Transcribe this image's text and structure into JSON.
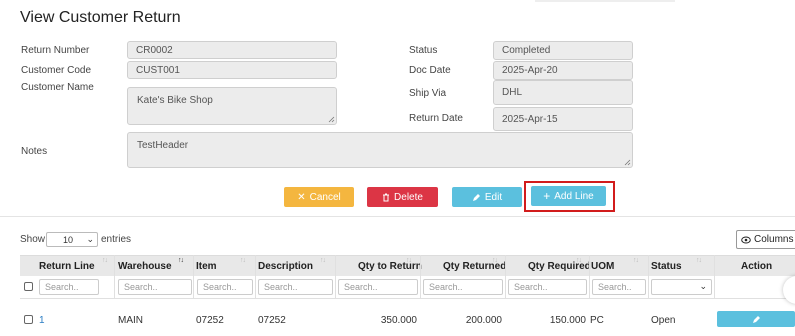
{
  "page": {
    "title": "View Customer Return"
  },
  "form": {
    "return_number": {
      "label": "Return Number",
      "value": "CR0002"
    },
    "customer_code": {
      "label": "Customer Code",
      "value": "CUST001"
    },
    "customer_name": {
      "label": "Customer Name",
      "value": "Kate's Bike Shop"
    },
    "notes": {
      "label": "Notes",
      "value": "TestHeader"
    },
    "status": {
      "label": "Status",
      "value": "Completed"
    },
    "doc_date": {
      "label": "Doc Date",
      "value": "2025-Apr-20"
    },
    "ship_via": {
      "label": "Ship Via",
      "value": "DHL"
    },
    "return_date": {
      "label": "Return Date",
      "value": "2025-Apr-15"
    }
  },
  "actions": {
    "cancel": "Cancel",
    "delete": "Delete",
    "edit": "Edit",
    "add_line": "Add Line"
  },
  "table_controls": {
    "show": "Show",
    "entries_value": "10",
    "entries": "entries",
    "columns_button": "Columns"
  },
  "table": {
    "headers": [
      "Return Line",
      "Warehouse",
      "Item",
      "Description",
      "Qty to Return",
      "Qty Returned",
      "Qty Required",
      "UOM",
      "Status",
      "Action"
    ],
    "search_placeholder": "Search..",
    "rows": [
      {
        "return_line": "1",
        "warehouse": "MAIN",
        "item": "07252",
        "description": "07252",
        "qty_to_return": "350.000",
        "qty_returned": "200.000",
        "qty_required": "150.000",
        "uom": "PC",
        "status": "Open"
      }
    ]
  },
  "colors": {
    "cancel": "#f4b63f",
    "delete": "#dc3545",
    "primary": "#5bc0de",
    "highlight": "#d21c1c",
    "link": "#2a7dc4"
  },
  "icons": {
    "cancel": "times-icon",
    "delete": "trash-icon",
    "edit": "pencil-icon",
    "add": "plus-icon",
    "columns": "eye-icon",
    "row_action": "pencil-icon"
  }
}
